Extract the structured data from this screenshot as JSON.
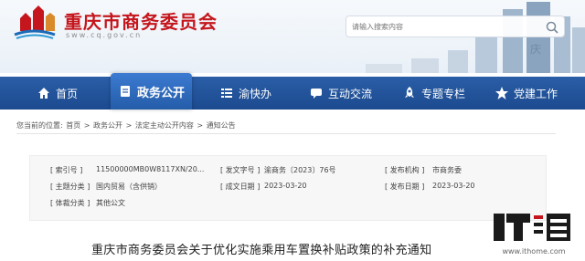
{
  "header": {
    "site_title": "重庆市商务委员会",
    "site_url": "sww.cq.gov.cn",
    "search_placeholder": "请输入搜索内容"
  },
  "nav": {
    "items": [
      {
        "label": "首页",
        "icon": "home-icon"
      },
      {
        "label": "政务公开",
        "icon": "document-icon",
        "active": true
      },
      {
        "label": "渝快办",
        "icon": "service-list-icon"
      },
      {
        "label": "互动交流",
        "icon": "chat-icon"
      },
      {
        "label": "专题专栏",
        "icon": "rocket-icon"
      },
      {
        "label": "党建工作",
        "icon": "star-icon"
      }
    ]
  },
  "breadcrumb": {
    "prefix": "您当前的位置:",
    "items": [
      "首页",
      "政务公开",
      "法定主动公开内容",
      "通知公告"
    ],
    "separator": ">"
  },
  "info": {
    "index_label": "[ 索引号 ]",
    "index_value": "11500000MB0W8117XN/20...",
    "doc_no_label": "[ 发文字号 ]",
    "doc_no_value": "渝商务〔2023〕76号",
    "issuer_label": "[ 发布机构 ]",
    "issuer_value": "市商务委",
    "subject_label": "[ 主题分类 ]",
    "subject_value": "国内贸易（含供销）",
    "created_label": "[ 成文日期 ]",
    "created_value": "2023-03-20",
    "published_label": "[ 发布日期 ]",
    "published_value": "2023-03-20",
    "genre_label": "[ 体裁分类 ]",
    "genre_value": "其他公文"
  },
  "document": {
    "title": "重庆市商务委员会关于优化实施乘用车置换补贴政策的补充通知"
  },
  "watermark": {
    "text": "www.ithome.com"
  },
  "colors": {
    "brand_red": "#c4161c",
    "nav_blue": "#1c4a8f",
    "nav_active": "#3c7bd2"
  }
}
